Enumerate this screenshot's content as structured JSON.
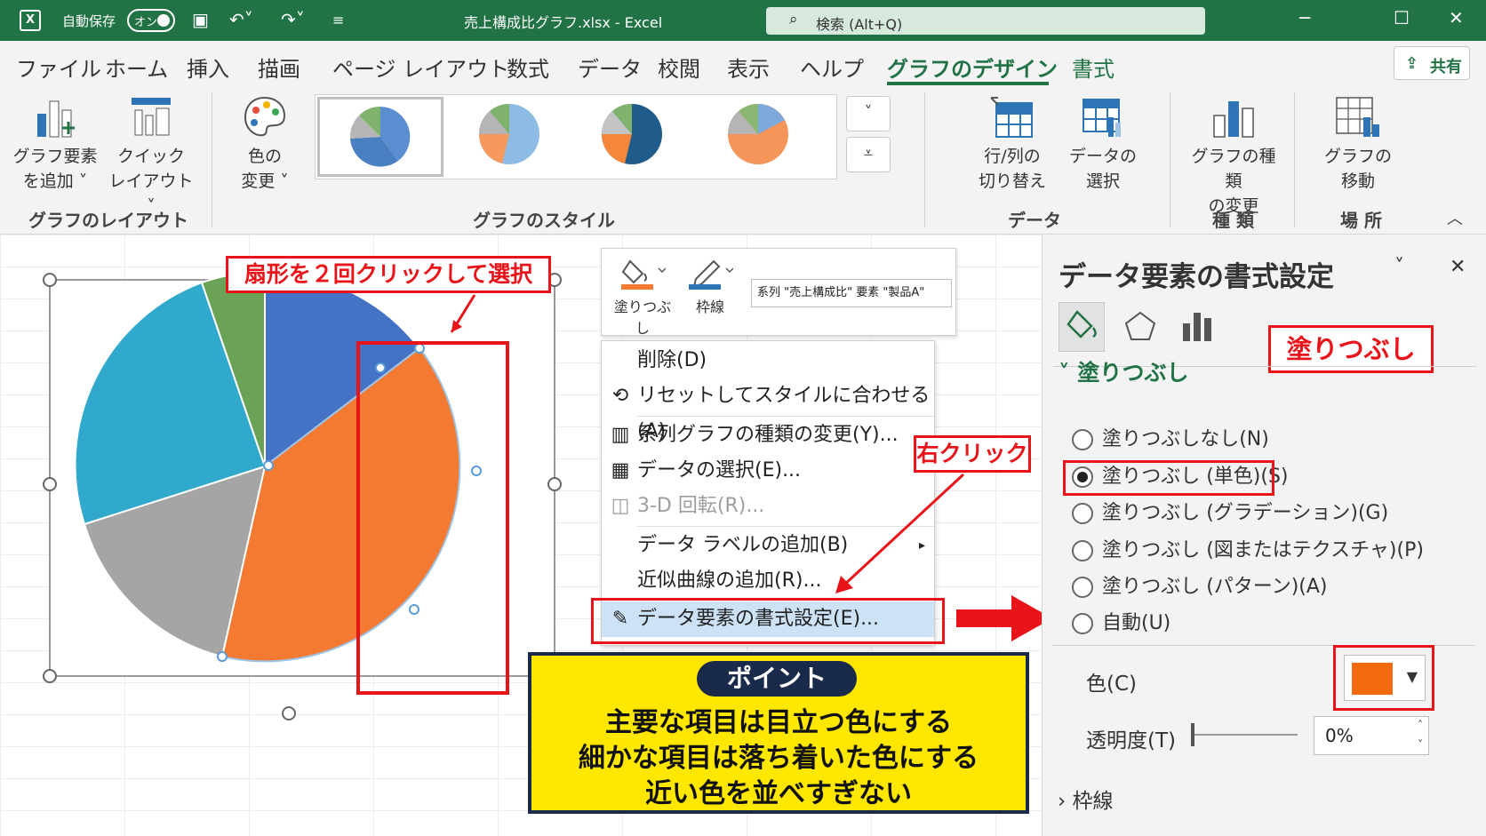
{
  "titlebar": {
    "autosave_label": "自動保存",
    "autosave_state": "オン",
    "doc_title": "売上構成比グラフ.xlsx  -  Excel",
    "search_placeholder": "検索 (Alt+Q)",
    "app_accent": "#217346"
  },
  "tabs": [
    {
      "label": "ファイル"
    },
    {
      "label": "ホーム"
    },
    {
      "label": "挿入"
    },
    {
      "label": "描画"
    },
    {
      "label": "ページ レイアウト"
    },
    {
      "label": "数式"
    },
    {
      "label": "データ"
    },
    {
      "label": "校閲"
    },
    {
      "label": "表示"
    },
    {
      "label": "ヘルプ"
    },
    {
      "label": "グラフのデザイン",
      "active": true
    },
    {
      "label": "書式"
    }
  ],
  "share_label": "共有",
  "ribbon": {
    "add_element": {
      "line1": "グラフ要素",
      "line2": "を追加 ˅"
    },
    "quick_layout": {
      "line1": "クイック",
      "line2": "レイアウト ˅"
    },
    "colors": {
      "line1": "色の",
      "line2": "変更 ˅"
    },
    "switch_rowcol": {
      "line1": "行/列の",
      "line2": "切り替え"
    },
    "select_data": {
      "line1": "データの",
      "line2": "選択"
    },
    "change_type": {
      "line1": "グラフの種類",
      "line2": "の変更"
    },
    "move_chart": {
      "line1": "グラフの",
      "line2": "移動"
    },
    "groups": {
      "layout": "グラフのレイアウト",
      "styles": "グラフのスタイル",
      "data": "データ",
      "type": "種 類",
      "location": "場 所"
    }
  },
  "chart": {
    "slices": [
      {
        "name": "blue",
        "color": "#4472c4"
      },
      {
        "name": "orange",
        "color": "#f37a30"
      },
      {
        "name": "gray",
        "color": "#a5a5a5"
      },
      {
        "name": "teal",
        "color": "#31a9cd"
      },
      {
        "name": "green",
        "color": "#6aa356"
      }
    ]
  },
  "callouts": {
    "top": "扇形を２回クリックして選択",
    "right_click": "右クリック"
  },
  "mini_toolbar": {
    "fill_label": "塗りつぶし",
    "outline_label": "枠線",
    "series_select": "系列 \"売上構成比\" 要素 \"製品A\""
  },
  "context_menu": {
    "items": [
      {
        "label": "削除(D)",
        "icon": ""
      },
      {
        "label": "リセットしてスタイルに合わせる(A)",
        "icon": "reset-icon"
      },
      {
        "label": "系列グラフの種類の変更(Y)...",
        "icon": "chart-type-icon"
      },
      {
        "label": "データの選択(E)...",
        "icon": "select-data-icon"
      },
      {
        "label": "3-D 回転(R)...",
        "icon": "cube-icon",
        "disabled": true
      },
      {
        "label": "データ ラベルの追加(B)",
        "icon": "",
        "submenu": true
      },
      {
        "label": "近似曲線の追加(R)...",
        "icon": ""
      },
      {
        "label": "データ要素の書式設定(E)...",
        "icon": "format-icon",
        "highlighted": true
      }
    ]
  },
  "point": {
    "badge": "ポイント",
    "lines": [
      "主要な項目は目立つ色にする",
      "細かな項目は落ち着いた色にする",
      "近い色を並べすぎない"
    ]
  },
  "pane": {
    "title": "データ要素の書式設定",
    "fill_callout": "塗りつぶし",
    "fill_section": "塗りつぶし",
    "options": [
      {
        "label": "塗りつぶしなし(N)",
        "checked": false
      },
      {
        "label": "塗りつぶし (単色)(S)",
        "checked": true
      },
      {
        "label": "塗りつぶし (グラデーション)(G)",
        "checked": false
      },
      {
        "label": "塗りつぶし (図またはテクスチャ)(P)",
        "checked": false
      },
      {
        "label": "塗りつぶし (パターン)(A)",
        "checked": false
      },
      {
        "label": "自動(U)",
        "checked": false
      }
    ],
    "color_label": "色(C)",
    "color_value": "#f36a10",
    "transparency_label": "透明度(T)",
    "transparency_value": "0%",
    "border_section": "枠線"
  }
}
